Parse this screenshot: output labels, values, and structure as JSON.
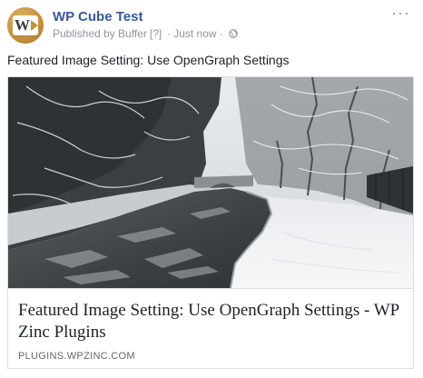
{
  "post": {
    "page_name": "WP Cube Test",
    "published_by": "Published by Buffer",
    "help_marker": "[?]",
    "separator": "·",
    "timestamp": "Just now",
    "privacy_icon": "globe-icon",
    "more_icon": "more-icon",
    "more_label": "···",
    "avatar_icon": "wp-cube-logo",
    "message": "Featured Image Setting: Use OpenGraph Settings"
  },
  "link_card": {
    "image_description_icon": "featured-image",
    "title": "Featured Image Setting: Use OpenGraph Settings - WP Zinc Plugins",
    "domain": "PLUGINS.WPZINC.COM"
  },
  "colors": {
    "page_name": "#365899",
    "meta_text": "#90949c",
    "body_text": "#1d2129",
    "card_border": "#dddfe2",
    "domain_text": "#606770",
    "avatar_brand": "#c6913f"
  }
}
